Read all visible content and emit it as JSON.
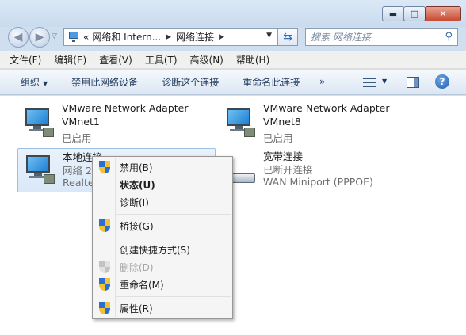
{
  "window": {
    "minimize_glyph": "▬",
    "maximize_glyph": "□",
    "close_glyph": "✕"
  },
  "address": {
    "prefix": "«",
    "crumbs": [
      "网络和 Intern...",
      "网络连接"
    ],
    "search_placeholder": "搜索 网络连接"
  },
  "menu": [
    "文件(F)",
    "编辑(E)",
    "查看(V)",
    "工具(T)",
    "高级(N)",
    "帮助(H)"
  ],
  "commands": {
    "organize": "组织",
    "disable_device": "禁用此网络设备",
    "diagnose": "诊断这个连接",
    "rename": "重命名此连接",
    "more": "»"
  },
  "connections": [
    {
      "name": "VMware Network Adapter",
      "line2": "VMnet1",
      "status": "已启用"
    },
    {
      "name": "VMware Network Adapter",
      "line2": "VMnet8",
      "status": "已启用"
    },
    {
      "name": "本地连接",
      "line2": "网络  2",
      "line3": "Realte"
    },
    {
      "name": "宽带连接",
      "line2": "已断开连接",
      "line3": "WAN Miniport (PPPOE)"
    }
  ],
  "context_menu": [
    {
      "label": "禁用(B)",
      "shield": true
    },
    {
      "label": "状态(U)",
      "bold": true
    },
    {
      "label": "诊断(I)"
    },
    {
      "label": "桥接(G)",
      "shield": true
    },
    {
      "label": "创建快捷方式(S)"
    },
    {
      "label": "删除(D)",
      "shield": true,
      "disabled": true
    },
    {
      "label": "重命名(M)",
      "shield": true
    },
    {
      "label": "属性(R)",
      "shield": true
    }
  ],
  "colors": {
    "accent": "#1e395b",
    "selection": "#d9e8f8",
    "close_button": "#c74a31"
  }
}
